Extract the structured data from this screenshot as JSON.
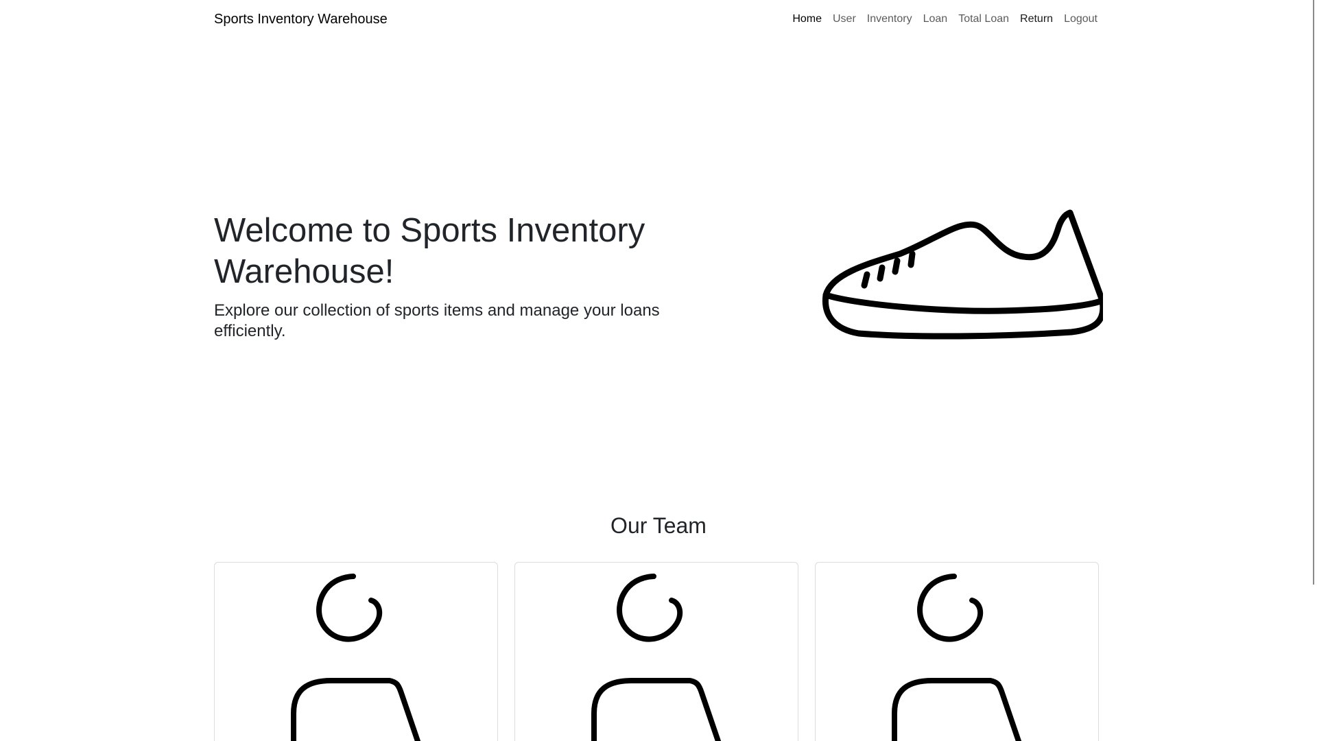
{
  "navbar": {
    "brand": "Sports Inventory Warehouse",
    "links": [
      {
        "label": "Home"
      },
      {
        "label": "User"
      },
      {
        "label": "Inventory"
      },
      {
        "label": "Loan"
      },
      {
        "label": "Total Loan"
      },
      {
        "label": "Return"
      },
      {
        "label": "Logout"
      }
    ]
  },
  "hero": {
    "title": "Welcome to Sports Inventory Warehouse!",
    "subtitle": "Explore our collection of sports items and manage your loans efficiently.",
    "image_icon": "sneaker-icon"
  },
  "team": {
    "title": "Our Team",
    "members": [
      {
        "icon": "person-icon"
      },
      {
        "icon": "person-icon"
      },
      {
        "icon": "person-icon"
      }
    ]
  }
}
